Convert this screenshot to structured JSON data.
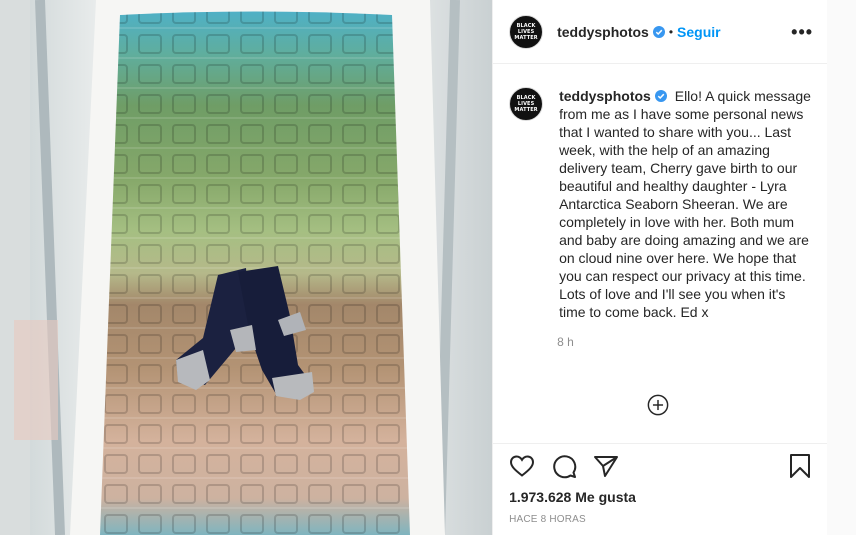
{
  "post": {
    "username": "teddysphotos",
    "follow_label": "Seguir",
    "more_label": "•••",
    "avatar_lines": [
      "BLACK",
      "LIVES",
      "MATTER"
    ],
    "caption": "Ello! A quick message from me as I have some personal news that I wanted to share with you... Last week, with the help of an amazing delivery team, Cherry gave birth to our beautiful and healthy daughter - Lyra Antarctica Seaborn Sheeran. We are completely in love with her. Both mum and baby are doing amazing and we are on cloud nine over here. We hope that you can respect our privacy at this time. Lots of love and I'll see you when it's time to come back. Ed x",
    "caption_time": "8 h",
    "likes_count": "1.973.628",
    "likes_suffix": "Me gusta",
    "timestamp": "HACE 8 HORAS"
  },
  "icons": {
    "verified": "verified-badge-icon",
    "heart": "heart-icon",
    "comment": "comment-icon",
    "share": "share-icon",
    "bookmark": "bookmark-icon",
    "load_more": "plus-circle-icon"
  },
  "colors": {
    "accent": "#0095f6",
    "text": "#262626",
    "muted": "#8e8e8e",
    "border": "#efefef"
  }
}
